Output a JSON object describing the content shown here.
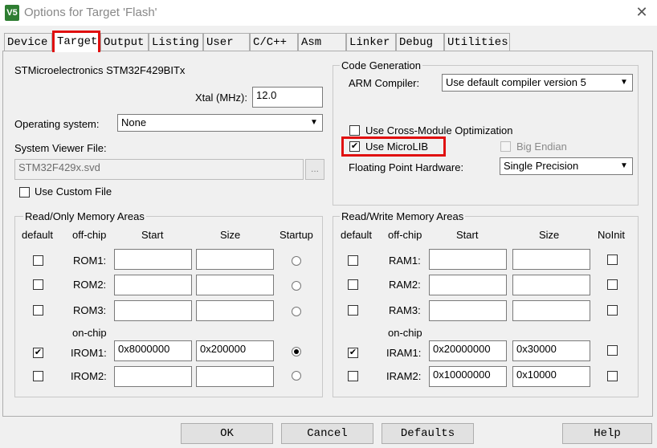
{
  "window": {
    "title": "Options for Target 'Flash'",
    "app_icon": "V5"
  },
  "tabs": [
    {
      "label": "Device"
    },
    {
      "label": "Target"
    },
    {
      "label": "Output"
    },
    {
      "label": "Listing"
    },
    {
      "label": "User"
    },
    {
      "label": "C/C++"
    },
    {
      "label": "Asm"
    },
    {
      "label": "Linker"
    },
    {
      "label": "Debug"
    },
    {
      "label": "Utilities"
    }
  ],
  "target": {
    "device_name": "STMicroelectronics STM32F429BITx",
    "xtal_label": "Xtal (MHz):",
    "xtal_value": "12.0",
    "os_label": "Operating system:",
    "os_value": "None",
    "svf_label": "System Viewer File:",
    "svf_value": "STM32F429x.svd",
    "browse_label": "...",
    "custom_file_label": "Use Custom File"
  },
  "codegen": {
    "title": "Code Generation",
    "compiler_label": "ARM Compiler:",
    "compiler_value": "Use default compiler version 5",
    "cross_module_label": "Use Cross-Module Optimization",
    "microlib_label": "Use MicroLIB",
    "microlib_check": "✔",
    "big_endian_label": "Big Endian",
    "fpu_label": "Floating Point Hardware:",
    "fpu_value": "Single Precision"
  },
  "ro_memory": {
    "title": "Read/Only Memory Areas",
    "headers": {
      "default": "default",
      "offchip": "off-chip",
      "start": "Start",
      "size": "Size",
      "startup": "Startup"
    },
    "onchip_label": "on-chip",
    "rows": [
      {
        "name": "ROM1:",
        "start": "",
        "size": "",
        "default": "",
        "startup": false
      },
      {
        "name": "ROM2:",
        "start": "",
        "size": "",
        "default": "",
        "startup": false
      },
      {
        "name": "ROM3:",
        "start": "",
        "size": "",
        "default": "",
        "startup": false
      },
      {
        "name": "IROM1:",
        "start": "0x8000000",
        "size": "0x200000",
        "default": "✔",
        "startup": true
      },
      {
        "name": "IROM2:",
        "start": "",
        "size": "",
        "default": "",
        "startup": false
      }
    ]
  },
  "rw_memory": {
    "title": "Read/Write Memory Areas",
    "headers": {
      "default": "default",
      "offchip": "off-chip",
      "start": "Start",
      "size": "Size",
      "noinit": "NoInit"
    },
    "onchip_label": "on-chip",
    "rows": [
      {
        "name": "RAM1:",
        "start": "",
        "size": "",
        "default": ""
      },
      {
        "name": "RAM2:",
        "start": "",
        "size": "",
        "default": ""
      },
      {
        "name": "RAM3:",
        "start": "",
        "size": "",
        "default": ""
      },
      {
        "name": "IRAM1:",
        "start": "0x20000000",
        "size": "0x30000",
        "default": "✔"
      },
      {
        "name": "IRAM2:",
        "start": "0x10000000",
        "size": "0x10000",
        "default": ""
      }
    ]
  },
  "buttons": {
    "ok": "OK",
    "cancel": "Cancel",
    "defaults": "Defaults",
    "help": "Help"
  },
  "colors": {
    "highlight": "#e01010",
    "background": "#f0f0f0"
  }
}
